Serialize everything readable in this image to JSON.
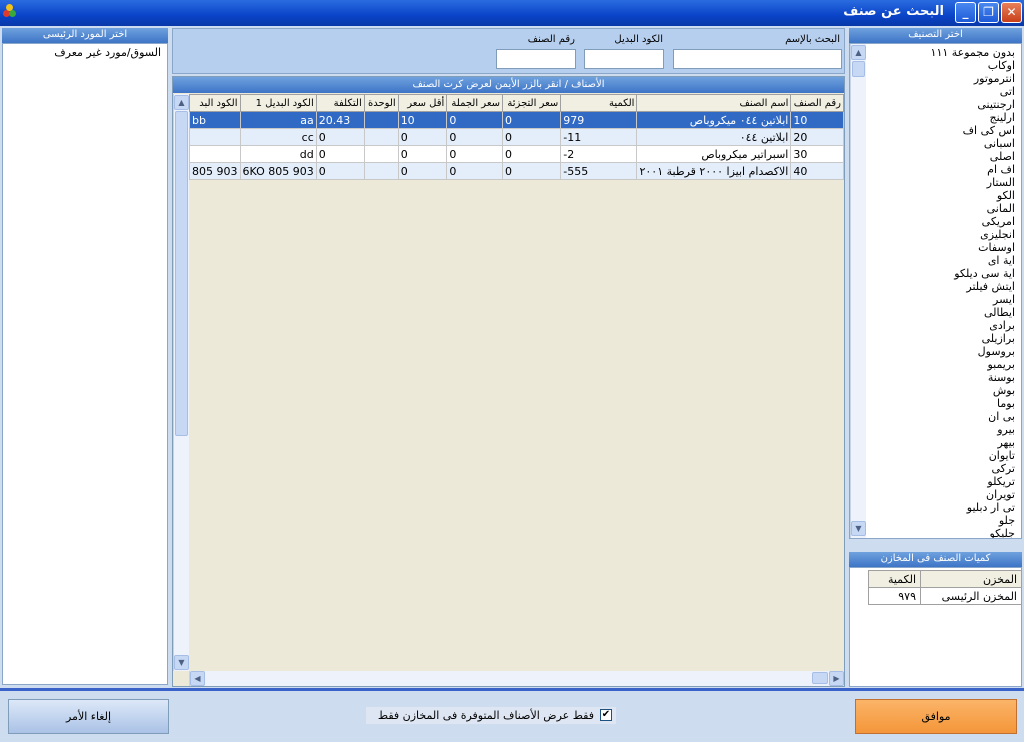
{
  "window": {
    "title": "البحث عن صنف",
    "close_glyph": "✕",
    "restore_glyph": "❐",
    "minimize_glyph": "_",
    "accent": "#0a43c8"
  },
  "supplier_panel": {
    "header": "اختر المورد الرئيسى",
    "items": [
      "السوق/مورد غير معرف"
    ]
  },
  "search": {
    "by_name_label": "البحث بالإسم",
    "alt_code_label": "الكود البديل",
    "item_no_label": "رقم الصنف",
    "by_name_value": "",
    "alt_code_value": "",
    "item_no_value": ""
  },
  "grid": {
    "caption": "الأصناف / انقر بالزر الأيمن لعرض كرت الصنف",
    "columns": [
      "رقم الصنف",
      "اسم الصنف",
      "الكمية",
      "سعر التجزئة",
      "سعر الجملة",
      "أقل سعر",
      "الوحدة",
      "التكلفة",
      "الكود البديل 1",
      "الكود البد"
    ],
    "rows": [
      {
        "item_no": "10",
        "name": "ابلاتين ٠٤٤  ميكروباص",
        "qty": "979",
        "retail": "0",
        "wholesale": "0",
        "min_price": "10",
        "unit": "",
        "cost": "20.43",
        "alt1": "aa",
        "alt2": "bb"
      },
      {
        "item_no": "20",
        "name": "ابلاتين ٠٤٤",
        "qty": "-11",
        "retail": "0",
        "wholesale": "0",
        "min_price": "0",
        "unit": "",
        "cost": "0",
        "alt1": "cc",
        "alt2": ""
      },
      {
        "item_no": "30",
        "name": "اسبراتير ميكروباص",
        "qty": "-2",
        "retail": "0",
        "wholesale": "0",
        "min_price": "0",
        "unit": "",
        "cost": "0",
        "alt1": "dd",
        "alt2": ""
      },
      {
        "item_no": "40",
        "name": "الاكصدام ابيزا ٢٠٠٠ قرطبة ٢٠٠١",
        "qty": "-555",
        "retail": "0",
        "wholesale": "0",
        "min_price": "0",
        "unit": "",
        "cost": "0",
        "alt1": "6KO 805 903",
        "alt2": "805 903"
      }
    ],
    "selected_row": 0,
    "selected_color": "#316ac5"
  },
  "category_panel": {
    "header": "اختر التصنيف",
    "items": [
      "بدون مجموعة ١١١",
      "اوكاب",
      "انترموتور",
      "اتى",
      "ارجنتينى",
      "ارلينج",
      "اس كى اف",
      "اسبانى",
      "اصلى",
      "اف ام",
      "الستار",
      "الكو",
      "المانى",
      "امريكى",
      "انجليزى",
      "اوسفات",
      "اية اى",
      "اية سى ديلكو",
      "ايتش فيلتر",
      "ايسر",
      "ايطالى",
      "برادى",
      "برازيلى",
      "بروسول",
      "بريمبو",
      "بوسنة",
      "بوش",
      "بوما",
      "بى ان",
      "بيرو",
      "بيهر",
      "تايوان",
      "تركى",
      "تريكلو",
      "تويران",
      "تى ار دبليو",
      "جلو",
      "جليكو"
    ]
  },
  "stores_panel": {
    "header": "كميات الصنف فى المخازن",
    "col_store": "المخزن",
    "col_qty": "الكمية",
    "rows": [
      {
        "store": "المخزن الرئيسى",
        "qty": "٩٧٩"
      }
    ]
  },
  "bottom": {
    "cancel_label": "إلغاء الأمر",
    "ok_label": "موافق",
    "filter_label": "فقط عرض الأصناف المتوفرة فى المخازن فقط",
    "filter_checked": true,
    "check_glyph": "✔",
    "ok_color": "#f4963a"
  },
  "scroll_glyphs": {
    "up": "▲",
    "down": "▼",
    "left": "◀",
    "right": "▶"
  }
}
